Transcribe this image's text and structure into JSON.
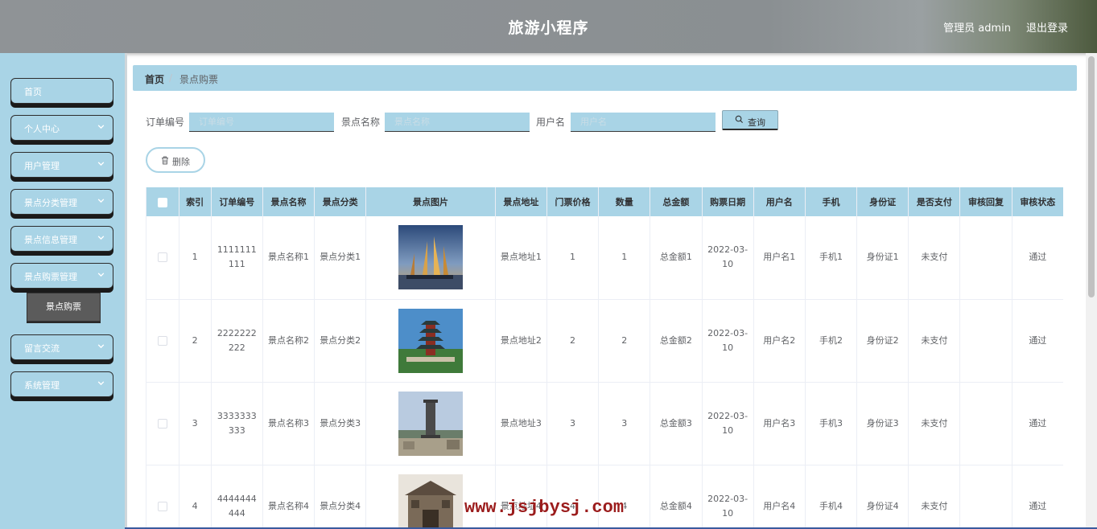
{
  "header": {
    "title": "旅游小程序",
    "admin_label": "管理员 admin",
    "logout_label": "退出登录"
  },
  "sidebar": {
    "items": [
      {
        "label": "首页",
        "has_arrow": false
      },
      {
        "label": "个人中心",
        "has_arrow": true
      },
      {
        "label": "用户管理",
        "has_arrow": true
      },
      {
        "label": "景点分类管理",
        "has_arrow": true
      },
      {
        "label": "景点信息管理",
        "has_arrow": true
      },
      {
        "label": "景点购票管理",
        "has_arrow": true
      },
      {
        "label": "留言交流",
        "has_arrow": true
      },
      {
        "label": "系统管理",
        "has_arrow": true
      }
    ],
    "sub_item": {
      "label": "景点购票"
    }
  },
  "breadcrumb": {
    "home": "首页",
    "separator": "/",
    "current": "景点购票"
  },
  "search": {
    "order_label": "订单编号",
    "order_placeholder": "订单编号",
    "spot_label": "景点名称",
    "spot_placeholder": "景点名称",
    "user_label": "用户名",
    "user_placeholder": "用户名",
    "query_button": "查询"
  },
  "actions": {
    "delete_button": "删除"
  },
  "table": {
    "columns": [
      "索引",
      "订单编号",
      "景点名称",
      "景点分类",
      "景点图片",
      "景点地址",
      "门票价格",
      "数量",
      "总金额",
      "购票日期",
      "用户名",
      "手机",
      "身份证",
      "是否支付",
      "审核回复",
      "审核状态"
    ],
    "rows": [
      {
        "index": "1",
        "order": "1111111111",
        "name": "景点名称1",
        "category": "景点分类1",
        "image": "sailing-ships-skyline",
        "address": "景点地址1",
        "price": "1",
        "qty": "1",
        "total": "总金额1",
        "date": "2022-03-10",
        "user": "用户名1",
        "phone": "手机1",
        "id_card": "身份证1",
        "paid": "未支付",
        "reply": "",
        "status": "通过"
      },
      {
        "index": "2",
        "order": "2222222222",
        "name": "景点名称2",
        "category": "景点分类2",
        "image": "pagoda-tower",
        "address": "景点地址2",
        "price": "2",
        "qty": "2",
        "total": "总金额2",
        "date": "2022-03-10",
        "user": "用户名2",
        "phone": "手机2",
        "id_card": "身份证2",
        "paid": "未支付",
        "reply": "",
        "status": "通过"
      },
      {
        "index": "3",
        "order": "3333333333",
        "name": "景点名称3",
        "category": "景点分类3",
        "image": "monument-city-view",
        "address": "景点地址3",
        "price": "3",
        "qty": "3",
        "total": "总金额3",
        "date": "2022-03-10",
        "user": "用户名3",
        "phone": "手机3",
        "id_card": "身份证3",
        "paid": "未支付",
        "reply": "",
        "status": "通过"
      },
      {
        "index": "4",
        "order": "4444444444",
        "name": "景点名称4",
        "category": "景点分类4",
        "image": "ancient-gate",
        "address": "景点地址4",
        "price": "4",
        "qty": "4",
        "total": "总金额4",
        "date": "2022-03-10",
        "user": "用户名4",
        "phone": "手机4",
        "id_card": "身份证4",
        "paid": "未支付",
        "reply": "",
        "status": "通过"
      }
    ]
  },
  "watermark": "www.jsjbysj.com",
  "colors": {
    "accent": "#a9d4e6",
    "sidebar_bg": "#a9d4e6",
    "header_bg": "#8f9396",
    "active_sub": "#5b5b5b",
    "watermark": "#9b1c1c"
  }
}
